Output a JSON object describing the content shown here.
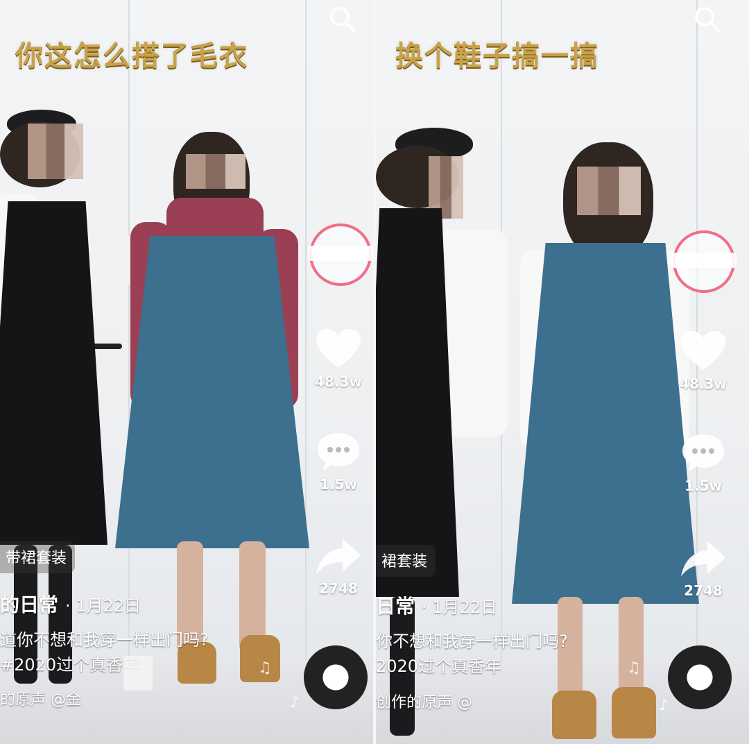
{
  "left": {
    "caption": "你这怎么搭了毛衣",
    "likes": "48.3w",
    "comments": "1.5w",
    "shares": "2748",
    "tag": "带裙套装",
    "author": "的日常",
    "date": "· 1月22日",
    "desc_line1": "道你不想和我穿一样出门吗?",
    "desc_line2": "#2020过个真香年",
    "music": "的原声   @金"
  },
  "right": {
    "caption": "换个鞋子搞一搞",
    "likes": "48.3w",
    "comments": "1.5w",
    "shares": "2748",
    "tag": "裙套装",
    "author": "日常",
    "date": "· 1月22日",
    "desc_line1": "你不想和我穿一样出门吗?",
    "desc_line2": "2020过个真香年",
    "music": "创作的原声   @"
  },
  "colors": {
    "caption": "#c8a24a",
    "accent_ring": "#f06e86",
    "teal_dress": "#3d6f8f",
    "maroon_sweater": "#9b3f55",
    "black_dress": "#151517"
  },
  "icons": [
    "search-icon",
    "heart-icon",
    "comment-icon",
    "share-icon",
    "music-disc-icon",
    "music-note-icon"
  ]
}
